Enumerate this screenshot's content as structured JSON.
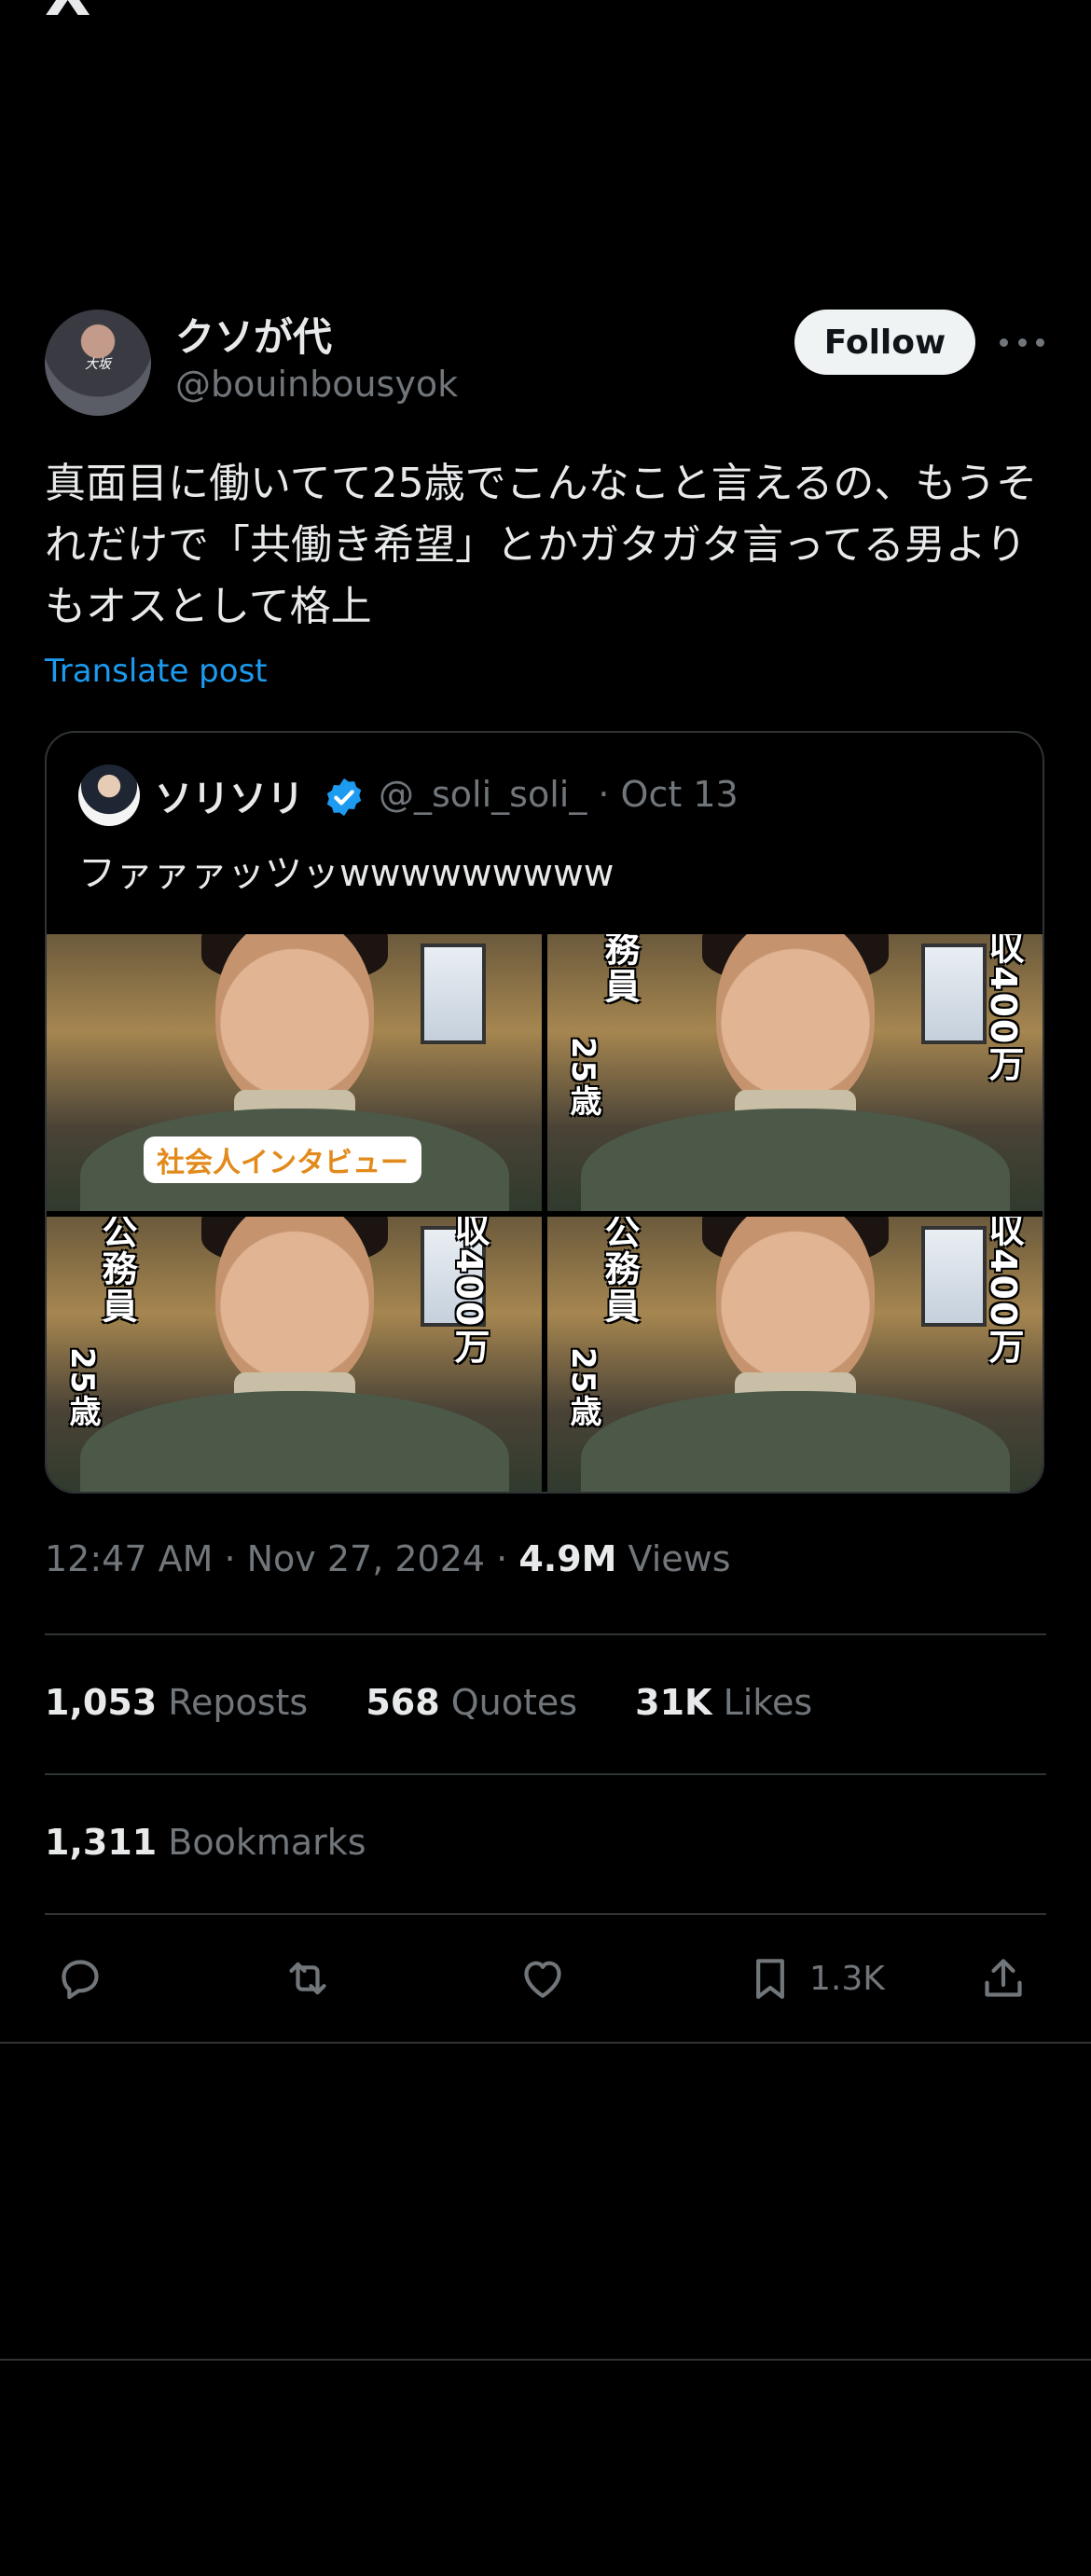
{
  "window": {
    "close_label": "X"
  },
  "author": {
    "display_name": "クソが代",
    "handle": "@bouinbousyok",
    "avatar_text": "大坂",
    "follow_label": "Follow"
  },
  "post": {
    "text": "真面目に働いてて25歳でこんなこと言えるの、もうそれだけで「共働き希望」とかガタガタ言ってる男よりもオスとして格上",
    "translate_label": "Translate post"
  },
  "quote": {
    "name": "ソリソリ",
    "handle_date": "@_soli_soli_ · Oct 13",
    "text": "ファァァッツッwwwwwwwww",
    "media": {
      "caption": "社会人インタビュー",
      "job_label": "公務員",
      "job_label_cropped": "務員",
      "age_label": "25歳",
      "income_label": "収400万"
    }
  },
  "meta": {
    "timestamp": "12:47 AM · Nov 27, 2024 · ",
    "views_count": "4.9M",
    "views_label": " Views"
  },
  "stats": {
    "reposts_count": "1,053",
    "reposts_label": " Reposts",
    "quotes_count": "568",
    "quotes_label": " Quotes",
    "likes_count": "31K",
    "likes_label": " Likes",
    "bookmarks_count": "1,311",
    "bookmarks_label": " Bookmarks"
  },
  "actions": {
    "reply_icon": "reply-icon",
    "repost_icon": "repost-icon",
    "like_icon": "heart-icon",
    "bookmark_icon": "bookmark-icon",
    "bookmark_count": "1.3K",
    "share_icon": "share-icon"
  },
  "colors": {
    "background": "#000000",
    "text_primary": "#e7e9ea",
    "text_secondary": "#71767b",
    "link": "#1d9bf0",
    "verified": "#1d9bf0",
    "border": "#2f3336"
  }
}
